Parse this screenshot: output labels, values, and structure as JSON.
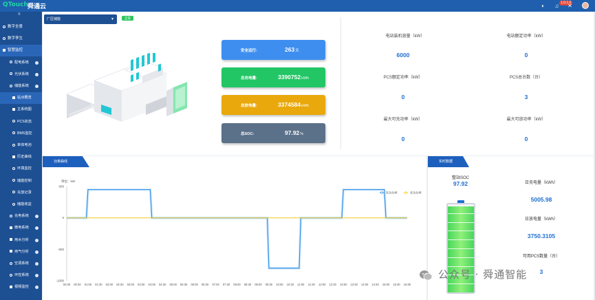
{
  "header": {
    "logo_brand": "QTouch",
    "logo_cn": "舜通云",
    "badge": "1,0,1,0"
  },
  "sidebar": {
    "collapse_icon": "menu-collapse-icon",
    "items": [
      {
        "label": "数字全景",
        "level": "top",
        "icon": "circle"
      },
      {
        "label": "数字孪生",
        "level": "top",
        "icon": "circle"
      },
      {
        "label": "智慧监控",
        "level": "top",
        "icon": "grid",
        "active": true
      },
      {
        "label": "配电系统",
        "level": "sub",
        "icon": "plug",
        "arrow": true
      },
      {
        "label": "光伏系统",
        "level": "sub",
        "icon": "sun",
        "arrow": true
      },
      {
        "label": "储能系统",
        "level": "sub",
        "icon": "battery",
        "arrow": true
      },
      {
        "label": "站点概览",
        "level": "sub2",
        "icon": "square",
        "active": true
      },
      {
        "label": "主系统图",
        "level": "sub2",
        "icon": "square"
      },
      {
        "label": "PCS状态",
        "level": "sub2",
        "icon": "circle"
      },
      {
        "label": "BMS监控",
        "level": "sub2",
        "icon": "circle"
      },
      {
        "label": "单体电池",
        "level": "sub2",
        "icon": "circle"
      },
      {
        "label": "历史曲线",
        "level": "sub2",
        "icon": "square"
      },
      {
        "label": "环境监控",
        "level": "sub2",
        "icon": "circle"
      },
      {
        "label": "储能控制",
        "level": "sub2",
        "icon": "circle"
      },
      {
        "label": "充放记录",
        "level": "sub2",
        "icon": "circle"
      },
      {
        "label": "储能收益",
        "level": "sub2",
        "icon": "circle"
      },
      {
        "label": "充电系统",
        "level": "sub",
        "icon": "circle",
        "arrow": true
      },
      {
        "label": "微电系统",
        "level": "sub",
        "icon": "grid",
        "arrow": true
      },
      {
        "label": "用水分析",
        "level": "sub",
        "icon": "grid",
        "arrow": true
      },
      {
        "label": "用气分析",
        "level": "sub",
        "icon": "grid",
        "arrow": true
      },
      {
        "label": "空调系统",
        "level": "sub",
        "icon": "circle",
        "arrow": true
      },
      {
        "label": "环控系统",
        "level": "sub",
        "icon": "circle",
        "arrow": true
      },
      {
        "label": "视频监控",
        "level": "sub",
        "icon": "grid",
        "arrow": true
      }
    ]
  },
  "station": {
    "selected": "厂区储能",
    "status": "正常"
  },
  "cards": {
    "days_label": "安全运行:",
    "days_value": "263",
    "days_unit": "天",
    "charge_label": "总充电量:",
    "charge_value": "3390752",
    "charge_unit": "kWh",
    "discharge_label": "总放电量:",
    "discharge_value": "3374584",
    "discharge_unit": "kWh",
    "soc_label": "总SOC:",
    "soc_value": "97.92",
    "soc_unit": "%"
  },
  "metrics": {
    "m1_label": "电站装机容量（kW）",
    "m1_value": "6000",
    "m2_label": "电站额定功率（kW）",
    "m2_value": "0",
    "m3_label": "PCS额定功率（kW）",
    "m3_value": "0",
    "m4_label": "PCS总台数（台）",
    "m4_value": "3",
    "m5_label": "最大可充功率（kW）",
    "m5_value": "0",
    "m6_label": "最大可放功率（kW）",
    "m6_value": "0"
  },
  "chart_panel": {
    "tab": "功率曲线"
  },
  "chart_data": {
    "type": "line",
    "ylabel": "单位：kW",
    "ylim": [
      -1000,
      500
    ],
    "yticks": [
      500,
      0,
      -500,
      -1000
    ],
    "categories": [
      "00:00",
      "00:30",
      "01:00",
      "01:30",
      "02:00",
      "02:30",
      "03:00",
      "03:30",
      "04:00",
      "04:30",
      "05:00",
      "05:30",
      "06:00",
      "06:30",
      "07:00",
      "07:30",
      "08:00",
      "08:30",
      "09:00",
      "09:30",
      "10:00",
      "10:30",
      "11:00",
      "11:30",
      "12:00",
      "12:30",
      "13:00",
      "13:30",
      "14:00",
      "14:30",
      "15:00",
      "15:30",
      "16:00"
    ],
    "series": [
      {
        "name": "有功功率",
        "color": "#2b8fe6",
        "values": [
          0,
          0,
          450,
          450,
          450,
          450,
          450,
          450,
          0,
          0,
          0,
          0,
          0,
          0,
          0,
          0,
          0,
          0,
          0,
          -800,
          -800,
          -800,
          0,
          0,
          0,
          0,
          450,
          450,
          450,
          450,
          0,
          0,
          0
        ]
      },
      {
        "name": "无功功率",
        "color": "#f3c60f",
        "values": [
          0,
          0,
          0,
          0,
          0,
          0,
          0,
          0,
          0,
          0,
          0,
          0,
          0,
          0,
          0,
          0,
          0,
          0,
          0,
          0,
          0,
          0,
          0,
          0,
          0,
          0,
          0,
          0,
          0,
          0,
          0,
          0,
          0
        ]
      }
    ]
  },
  "data_panel": {
    "tab": "实时数据",
    "soc_label": "整站SOC",
    "soc_value": "97.92",
    "soc_fraction": 0.9792,
    "today_charge_label": "日充电量（kWh）",
    "today_charge_value": "5005.98",
    "today_discharge_label": "日放电量（kWh）",
    "today_discharge_value": "3750.3105",
    "pcs_label": "可用PCS数量（台）",
    "pcs_value": "3"
  },
  "watermark": "公众号 · 舜通智能",
  "colors": {
    "primary": "#1d4f93",
    "accent": "#1e6fd1",
    "green": "#22c665",
    "orange": "#e9a80c",
    "slate": "#5b7089"
  }
}
